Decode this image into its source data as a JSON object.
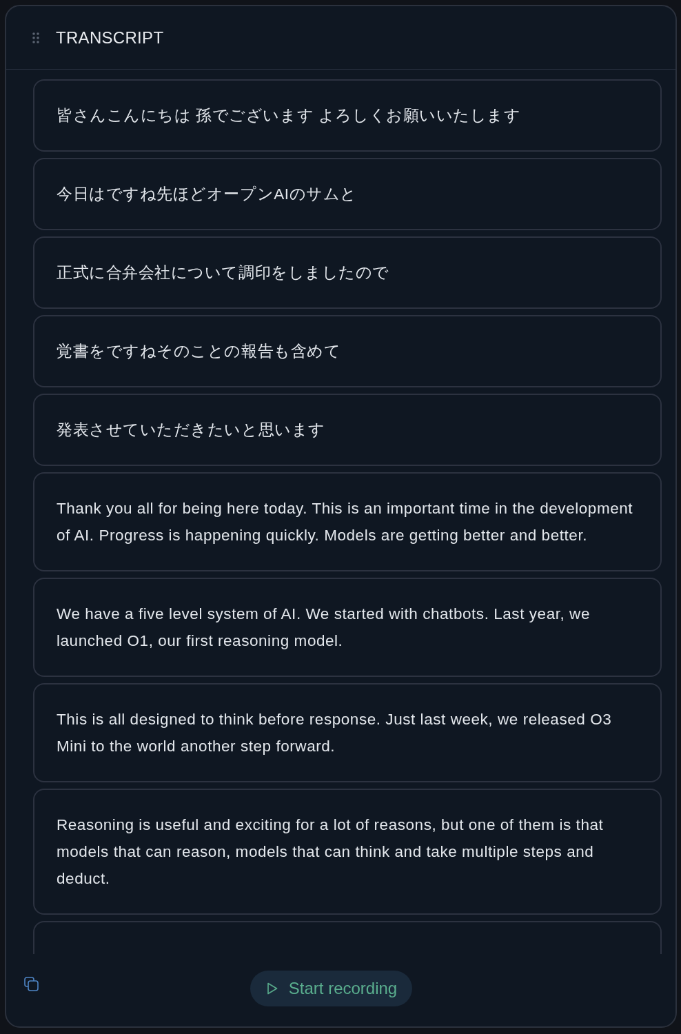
{
  "panel": {
    "title": "TRANSCRIPT"
  },
  "segments": [
    {
      "text": "皆さんこんにちは 孫でございます よろしくお願いいたします"
    },
    {
      "text": "今日はですね先ほどオープンAIのサムと"
    },
    {
      "text": "正式に合弁会社について調印をしましたので"
    },
    {
      "text": "覚書をですねそのことの報告も含めて"
    },
    {
      "text": "発表させていただきたいと思います"
    },
    {
      "text": "Thank you all for being here today. This is an important time in the development of AI. Progress is happening quickly. Models are getting better and better."
    },
    {
      "text": "We have a five level system of AI. We started with chatbots. Last year, we launched O1, our first reasoning model."
    },
    {
      "text": "This is all designed to think before response. Just last week, we released O3 Mini to the world another step forward."
    },
    {
      "text": "Reasoning is useful and exciting for a lot of reasons, but one of them is that models that can reason, models that can think and take multiple steps and deduct."
    }
  ],
  "more_below": true,
  "footer": {
    "record_button": {
      "label": "Start recording"
    }
  }
}
